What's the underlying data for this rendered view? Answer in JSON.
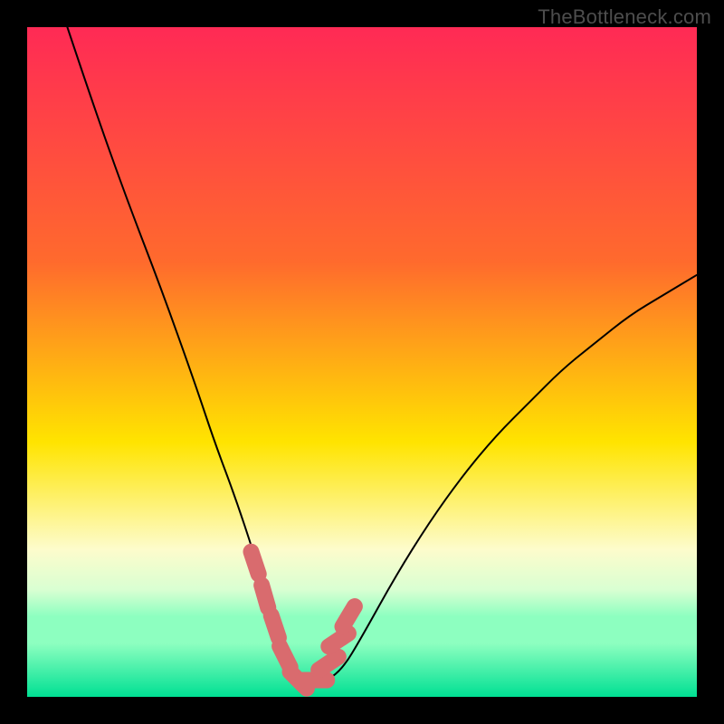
{
  "watermark": "TheBottleneck.com",
  "colors": {
    "background": "#000000",
    "gradient_top": "#ff2a55",
    "gradient_mid_top": "#ff6a2d",
    "gradient_mid": "#ffe400",
    "gradient_low1": "#fdfccc",
    "gradient_low2": "#d9ffd2",
    "gradient_low3": "#8dffc0",
    "gradient_bottom": "#00e093",
    "curve": "#000000",
    "marker_fill": "#d96b6e",
    "marker_stroke": "#d96b6e"
  },
  "chart_data": {
    "type": "line",
    "title": "",
    "xlabel": "",
    "ylabel": "",
    "xlim": [
      0,
      100
    ],
    "ylim": [
      0,
      100
    ],
    "series": [
      {
        "name": "bottleneck-curve",
        "x": [
          6,
          10,
          15,
          20,
          25,
          28,
          31,
          34,
          36,
          38,
          40,
          42,
          44,
          47,
          50,
          55,
          60,
          65,
          70,
          75,
          80,
          85,
          90,
          95,
          100
        ],
        "values": [
          100,
          88,
          74,
          61,
          47,
          38,
          30,
          21,
          14,
          8,
          4,
          2,
          2,
          4,
          9,
          18,
          26,
          33,
          39,
          44,
          49,
          53,
          57,
          60,
          63
        ]
      }
    ],
    "markers": {
      "name": "highlighted-range",
      "x": [
        34.0,
        35.5,
        37.0,
        38.5,
        40.5,
        43.0,
        45.0,
        46.5,
        48.0
      ],
      "values": [
        20.0,
        15.0,
        10.5,
        6.0,
        2.5,
        2.5,
        5.0,
        8.5,
        12.0
      ]
    },
    "gradient_stops_pct": [
      0,
      35,
      62,
      78,
      84,
      88,
      92,
      100
    ]
  }
}
